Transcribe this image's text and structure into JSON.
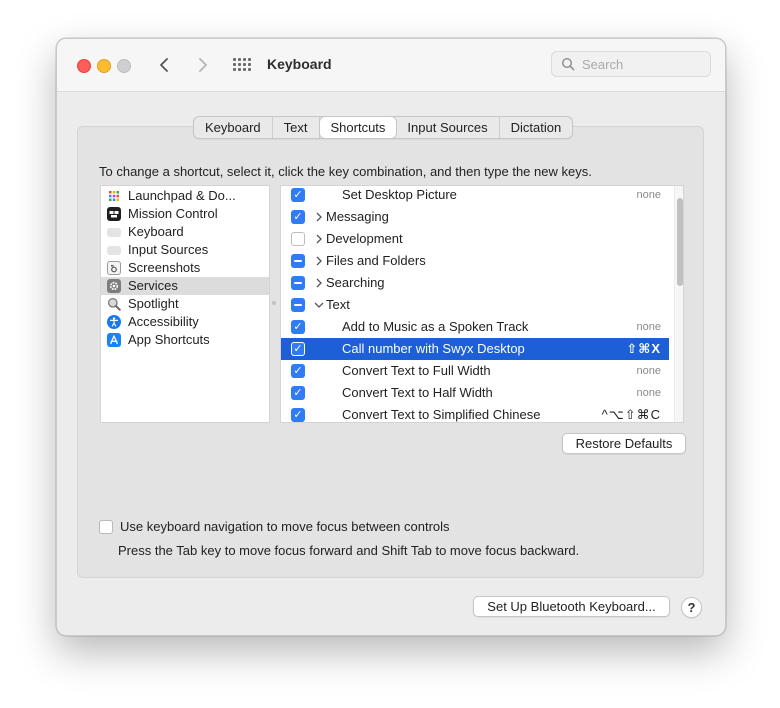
{
  "window": {
    "title": "Keyboard",
    "search_placeholder": "Search"
  },
  "tabs": [
    {
      "label": "Keyboard",
      "active": false
    },
    {
      "label": "Text",
      "active": false
    },
    {
      "label": "Shortcuts",
      "active": true
    },
    {
      "label": "Input Sources",
      "active": false
    },
    {
      "label": "Dictation",
      "active": false
    }
  ],
  "instructions": "To change a shortcut, select it, click the key combination, and then type the new keys.",
  "categories": [
    {
      "label": "Launchpad & Do...",
      "icon": "launchpad-icon",
      "selected": false
    },
    {
      "label": "Mission Control",
      "icon": "mission-control-icon",
      "selected": false
    },
    {
      "label": "Keyboard",
      "icon": "keyboard-icon",
      "selected": false
    },
    {
      "label": "Input Sources",
      "icon": "input-sources-icon",
      "selected": false
    },
    {
      "label": "Screenshots",
      "icon": "screenshots-icon",
      "selected": false
    },
    {
      "label": "Services",
      "icon": "gear-icon",
      "selected": true
    },
    {
      "label": "Spotlight",
      "icon": "spotlight-icon",
      "selected": false
    },
    {
      "label": "Accessibility",
      "icon": "accessibility-icon",
      "selected": false
    },
    {
      "label": "App Shortcuts",
      "icon": "app-store-icon",
      "selected": false
    }
  ],
  "shortcuts": [
    {
      "label": "Set Desktop Picture",
      "state": "checked",
      "indent": 2,
      "shortcut": "none",
      "selected": false
    },
    {
      "label": "Messaging",
      "state": "checked",
      "indent": 1,
      "expander": "collapsed",
      "shortcut": "",
      "selected": false
    },
    {
      "label": "Development",
      "state": "unchecked",
      "indent": 1,
      "expander": "collapsed",
      "shortcut": "",
      "selected": false
    },
    {
      "label": "Files and Folders",
      "state": "mixed",
      "indent": 1,
      "expander": "collapsed",
      "shortcut": "",
      "selected": false
    },
    {
      "label": "Searching",
      "state": "mixed",
      "indent": 1,
      "expander": "collapsed",
      "shortcut": "",
      "selected": false
    },
    {
      "label": "Text",
      "state": "mixed",
      "indent": 1,
      "expander": "expanded",
      "shortcut": "",
      "selected": false
    },
    {
      "label": "Add to Music as a Spoken Track",
      "state": "checked",
      "indent": 2,
      "shortcut": "none",
      "selected": false
    },
    {
      "label": "Call number with Swyx Desktop",
      "state": "checked",
      "indent": 2,
      "shortcut": "⇧⌘X",
      "selected": true
    },
    {
      "label": "Convert Text to Full Width",
      "state": "checked",
      "indent": 2,
      "shortcut": "none",
      "selected": false
    },
    {
      "label": "Convert Text to Half Width",
      "state": "checked",
      "indent": 2,
      "shortcut": "none",
      "selected": false
    },
    {
      "label": "Convert Text to Simplified Chinese",
      "state": "checked",
      "indent": 2,
      "shortcut": "^⌥⇧⌘C",
      "selected": false
    }
  ],
  "buttons": {
    "restore_defaults": "Restore Defaults",
    "setup_bluetooth": "Set Up Bluetooth Keyboard...",
    "help": "?"
  },
  "keyboard_navigation": {
    "label": "Use keyboard navigation to move focus between controls",
    "checked": false,
    "hint": "Press the Tab key to move focus forward and Shift Tab to move focus backward."
  },
  "colors": {
    "accent": "#2f7cf6",
    "selection": "#1c5fd6"
  }
}
